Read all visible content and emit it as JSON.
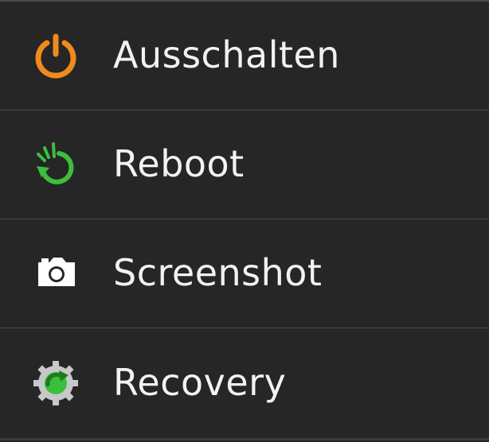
{
  "menu": {
    "items": [
      {
        "label": "Ausschalten",
        "icon": "power-icon",
        "color": "#f08a1c"
      },
      {
        "label": "Reboot",
        "icon": "reboot-icon",
        "color": "#3cbf3c"
      },
      {
        "label": "Screenshot",
        "icon": "camera-icon",
        "color": "#ffffff"
      },
      {
        "label": "Recovery",
        "icon": "recovery-gear-icon",
        "color": "#3cbf3c"
      }
    ]
  }
}
